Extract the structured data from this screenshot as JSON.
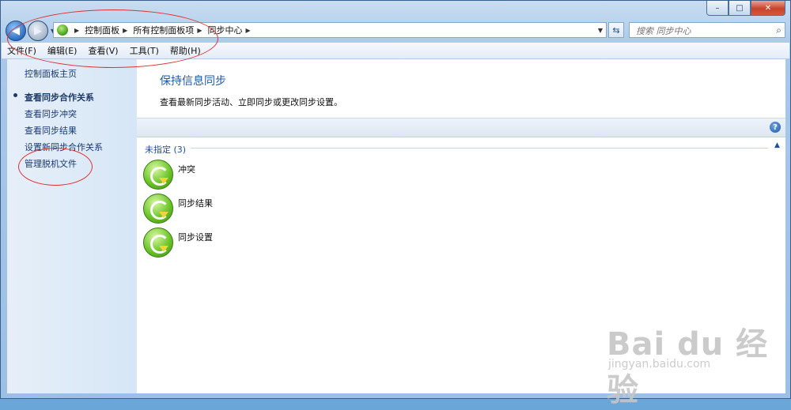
{
  "window": {
    "caption_buttons": {
      "minimize": "–",
      "maximize": "□",
      "close": "✕"
    }
  },
  "nav": {
    "back_icon": "back-arrow-icon",
    "forward_icon": "forward-arrow-icon",
    "breadcrumbs": [
      "控制面板",
      "所有控制面板项",
      "同步中心"
    ],
    "search": {
      "placeholder": "搜索 同步中心"
    }
  },
  "menubar": {
    "items": [
      "文件(F)",
      "编辑(E)",
      "查看(V)",
      "工具(T)",
      "帮助(H)"
    ]
  },
  "sidebar": {
    "items": [
      "控制面板主页",
      "查看同步合作关系",
      "查看同步冲突",
      "查看同步结果",
      "设置新同步合作关系",
      "管理脱机文件"
    ],
    "active_index": 1
  },
  "main": {
    "title": "保持信息同步",
    "description": "查看最新同步活动、立即同步或更改同步设置。",
    "group_label": "未指定 (3)",
    "items": [
      "冲突",
      "同步结果",
      "同步设置"
    ]
  },
  "watermark": {
    "main": "Bai du 经验",
    "sub": "jingyan.baidu.com"
  },
  "colors": {
    "link": "#1b3a6e",
    "title": "#1f5aa6",
    "annotation": "#e03030"
  }
}
